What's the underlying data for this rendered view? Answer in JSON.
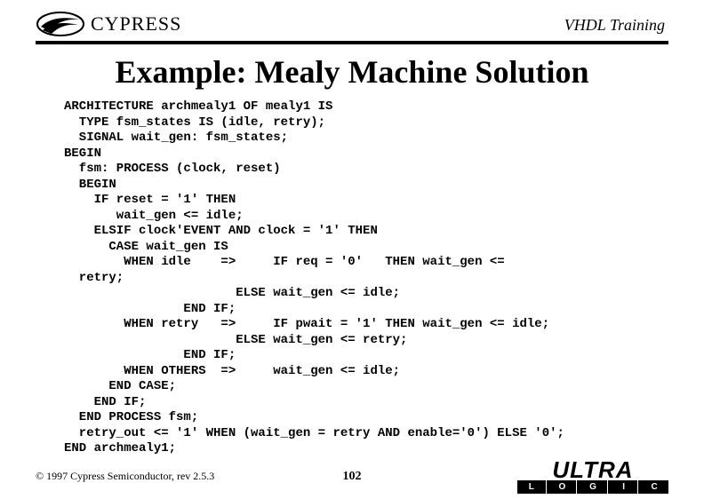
{
  "header": {
    "brand": "CYPRESS",
    "course": "VHDL Training"
  },
  "slide": {
    "title": "Example: Mealy Machine Solution",
    "code": "ARCHITECTURE archmealy1 OF mealy1 IS\n  TYPE fsm_states IS (idle, retry);\n  SIGNAL wait_gen: fsm_states;\nBEGIN\n  fsm: PROCESS (clock, reset)\n  BEGIN\n    IF reset = '1' THEN\n       wait_gen <= idle;\n    ELSIF clock'EVENT AND clock = '1' THEN\n      CASE wait_gen IS\n        WHEN idle    =>     IF req = '0'   THEN wait_gen <=\n  retry;\n                       ELSE wait_gen <= idle;\n                END IF;\n        WHEN retry   =>     IF pwait = '1' THEN wait_gen <= idle;\n                       ELSE wait_gen <= retry;\n                END IF;\n        WHEN OTHERS  =>     wait_gen <= idle;\n      END CASE;\n    END IF;\n  END PROCESS fsm;\n  retry_out <= '1' WHEN (wait_gen = retry AND enable='0') ELSE '0';\nEND archmealy1;"
  },
  "footer": {
    "copyright": "© 1997 Cypress Semiconductor, rev 2.5.3",
    "page": "102",
    "ultra_top": "ULTRA",
    "ultra_letters": [
      "L",
      "O",
      "G",
      "I",
      "C"
    ]
  }
}
